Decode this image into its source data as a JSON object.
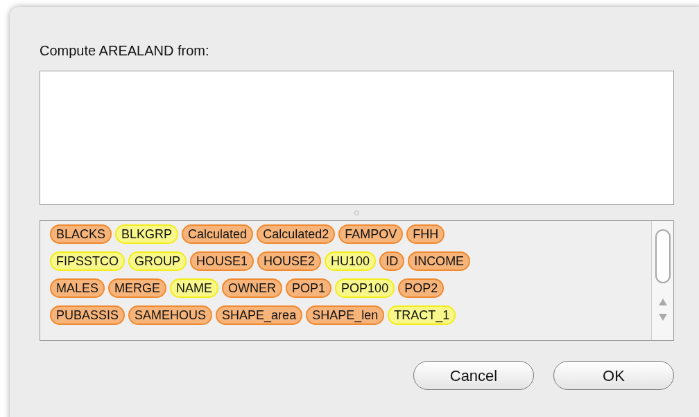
{
  "dialog": {
    "prompt": "Compute AREALAND from:",
    "field_rows": [
      [
        {
          "label": "BLACKS",
          "color": "#f7b47a"
        },
        {
          "label": "BLKGRP",
          "color": "#f8f78a"
        },
        {
          "label": "Calculated",
          "color": "#f7b47a"
        },
        {
          "label": "Calculated2",
          "color": "#f7b47a"
        },
        {
          "label": "FAMPOV",
          "color": "#f7b47a"
        },
        {
          "label": "FHH",
          "color": "#f7b47a"
        }
      ],
      [
        {
          "label": "FIPSSTCO",
          "color": "#f8f78a"
        },
        {
          "label": "GROUP",
          "color": "#f8f78a"
        },
        {
          "label": "HOUSE1",
          "color": "#f7b47a"
        },
        {
          "label": "HOUSE2",
          "color": "#f7b47a"
        },
        {
          "label": "HU100",
          "color": "#f8f78a"
        },
        {
          "label": "ID",
          "color": "#f7b47a"
        },
        {
          "label": "INCOME",
          "color": "#f7b47a"
        }
      ],
      [
        {
          "label": "MALES",
          "color": "#f7b47a"
        },
        {
          "label": "MERGE",
          "color": "#f7b47a"
        },
        {
          "label": "NAME",
          "color": "#f8f78a"
        },
        {
          "label": "OWNER",
          "color": "#f7b47a"
        },
        {
          "label": "POP1",
          "color": "#f7b47a"
        },
        {
          "label": "POP100",
          "color": "#f8f78a"
        },
        {
          "label": "POP2",
          "color": "#f7b47a"
        }
      ],
      [
        {
          "label": "PUBASSIS",
          "color": "#f7b47a"
        },
        {
          "label": "SAMEHOUS",
          "color": "#f7b47a"
        },
        {
          "label": "SHAPE_area",
          "color": "#f7b47a"
        },
        {
          "label": "SHAPE_len",
          "color": "#f7b47a"
        },
        {
          "label": "TRACT_1",
          "color": "#f8f78a"
        }
      ]
    ],
    "buttons": [
      "Cancel",
      "OK"
    ]
  }
}
